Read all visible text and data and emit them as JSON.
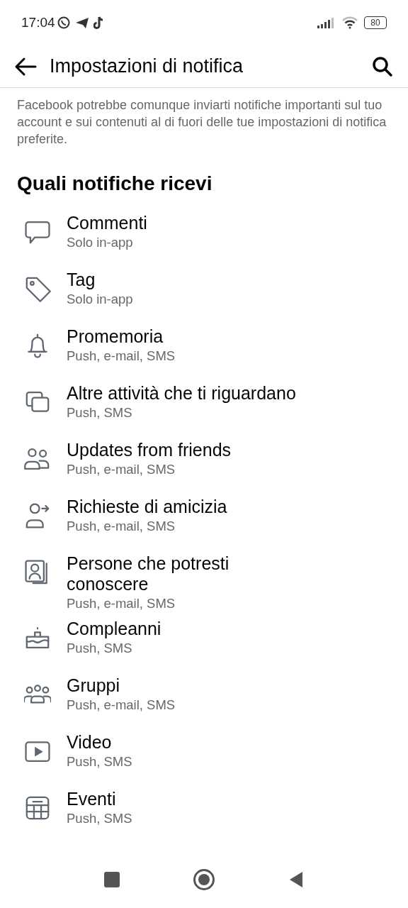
{
  "status_bar": {
    "time": "17:04",
    "battery": "80"
  },
  "header": {
    "title": "Impostazioni di notifica"
  },
  "note": "Facebook potrebbe comunque inviarti notifiche importanti sul tuo account e sui contenuti al di fuori delle tue impostazioni di notifica preferite.",
  "section": {
    "title": "Quali notifiche ricevi",
    "items": [
      {
        "kind": "comment",
        "title": "Commenti",
        "subtitle": "Solo in-app"
      },
      {
        "kind": "tag",
        "title": "Tag",
        "subtitle": "Solo in-app"
      },
      {
        "kind": "bell",
        "title": "Promemoria",
        "subtitle": "Push, e-mail, SMS"
      },
      {
        "kind": "windows",
        "title": "Altre attività che ti riguardano",
        "subtitle": "Push, SMS"
      },
      {
        "kind": "friends",
        "title": "Updates from friends",
        "subtitle": "Push, e-mail, SMS"
      },
      {
        "kind": "request",
        "title": "Richieste di amicizia",
        "subtitle": "Push, e-mail, SMS"
      },
      {
        "kind": "portrait",
        "title": "Persone che potresti conoscere",
        "subtitle": "Push, e-mail, SMS"
      },
      {
        "kind": "cake",
        "title": "Compleanni",
        "subtitle": "Push, SMS"
      },
      {
        "kind": "group",
        "title": "Gruppi",
        "subtitle": "Push, e-mail, SMS"
      },
      {
        "kind": "video",
        "title": "Video",
        "subtitle": "Push, SMS"
      },
      {
        "kind": "calendar",
        "title": "Eventi",
        "subtitle": "Push, SMS"
      }
    ]
  }
}
